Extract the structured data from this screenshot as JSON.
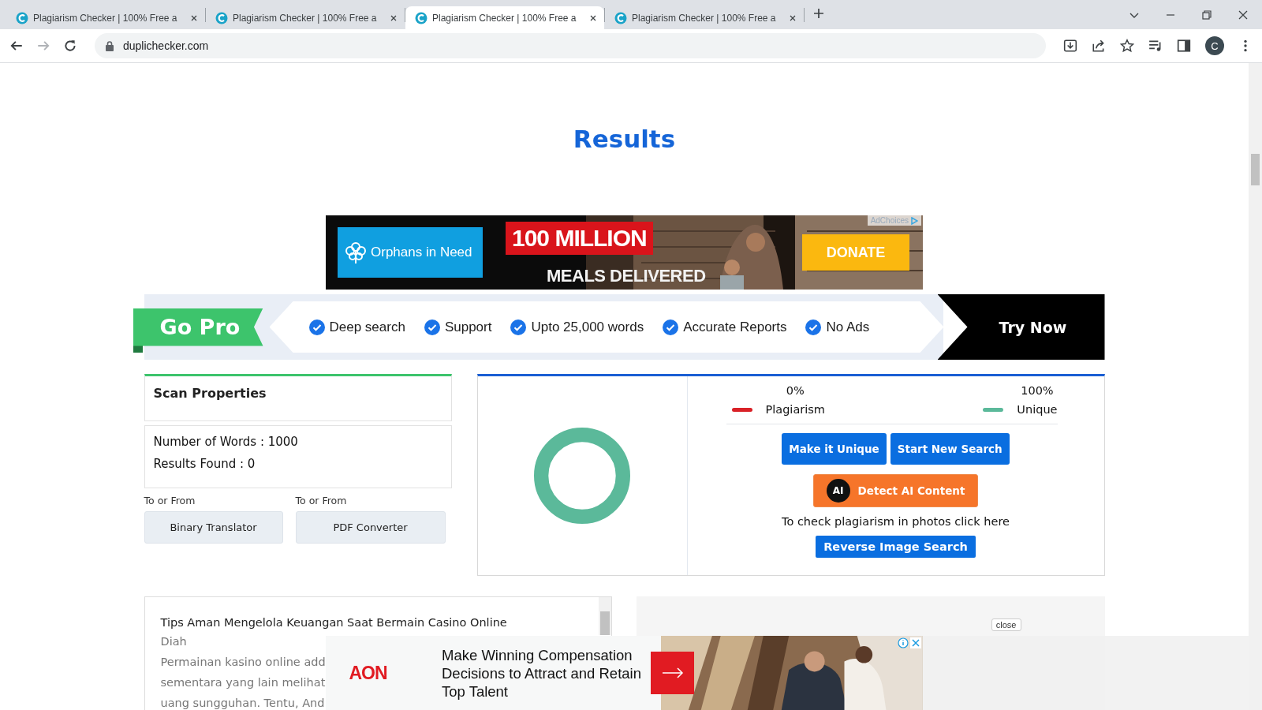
{
  "browser": {
    "tabs": [
      {
        "title": "Plagiarism Checker | 100% Free a",
        "selected": false
      },
      {
        "title": "Plagiarism Checker | 100% Free a",
        "selected": false
      },
      {
        "title": "Plagiarism Checker | 100% Free a",
        "selected": true
      },
      {
        "title": "Plagiarism Checker | 100% Free a",
        "selected": false
      }
    ],
    "url": "duplichecker.com",
    "profile_initial": "C"
  },
  "results_heading": {
    "title": "Results"
  },
  "top_ad": {
    "kind": "picture",
    "brand": "Orphans in Need",
    "headline": "100 MILLION",
    "subline": "MEALS DELIVERED",
    "cta": "DONATE",
    "adchoices": "AdChoices"
  },
  "go_pro": {
    "badge": "Go Pro",
    "features": [
      "Deep search",
      "Support",
      "Upto 25,000 words",
      "Accurate Reports",
      "No Ads"
    ],
    "cta": "Try Now"
  },
  "scan_properties": {
    "title": "Scan Properties",
    "stats": [
      "Number of Words : 1000",
      "Results Found : 0"
    ],
    "tools": [
      {
        "caption": "To or From",
        "button": "Binary Translator"
      },
      {
        "caption": "To or From",
        "button": "PDF Converter"
      }
    ]
  },
  "result": {
    "legend": [
      {
        "value": "0%",
        "label": "Plagiarism",
        "color": "#d92127"
      },
      {
        "value": "100%",
        "label": "Unique",
        "color": "#5bb99a"
      }
    ],
    "buttons": [
      "Make it Unique",
      "Start New Search"
    ],
    "ai_button": {
      "badge": "AI",
      "label": "Detect AI Content"
    },
    "photo_hint": "To check plagiarism in photos click here",
    "image_search": "Reverse Image Search"
  },
  "article": {
    "title": "Tips Aman Mengelola Keuangan Saat Bermain Casino Online",
    "author": "Diah",
    "lines": [
      "Permainan kasino online add",
      "sementara yang lain melihat",
      "uang sungguhan. Tentu, And"
    ]
  },
  "side_panel": {
    "close": "close"
  },
  "bottom_ad": {
    "kind": "picture",
    "brand": "AON",
    "text": "Make Winning Compensation Decisions to Attract and Retain Top Talent"
  }
}
